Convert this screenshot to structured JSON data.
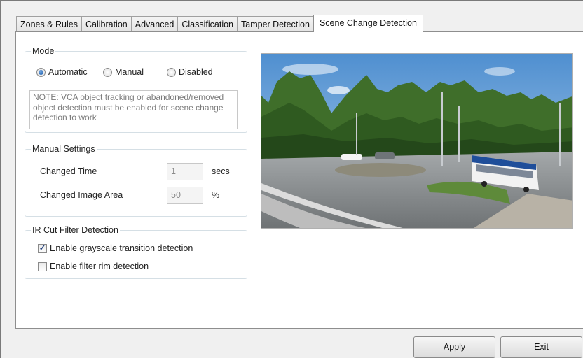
{
  "tabs": [
    {
      "label": "Zones & Rules"
    },
    {
      "label": "Calibration"
    },
    {
      "label": "Advanced"
    },
    {
      "label": "Classification"
    },
    {
      "label": "Tamper Detection"
    },
    {
      "label": "Scene Change Detection",
      "active": true
    }
  ],
  "mode": {
    "title": "Mode",
    "options": [
      "Automatic",
      "Manual",
      "Disabled"
    ],
    "selected": "Automatic",
    "note": "NOTE: VCA object tracking or abandoned/removed object detection must be enabled for scene change detection to work"
  },
  "manual_settings": {
    "title": "Manual Settings",
    "changed_time_label": "Changed Time",
    "changed_time_value": "1",
    "changed_time_unit": "secs",
    "changed_area_label": "Changed Image Area",
    "changed_area_value": "50",
    "changed_area_unit": "%"
  },
  "ir_cut": {
    "title": "IR Cut Filter Detection",
    "grayscale_label": "Enable grayscale transition detection",
    "grayscale_checked": true,
    "filter_rim_label": "Enable filter rim detection",
    "filter_rim_checked": false
  },
  "preview": {
    "icon": "camera-preview-image"
  },
  "buttons": {
    "apply": "Apply",
    "exit": "Exit"
  }
}
